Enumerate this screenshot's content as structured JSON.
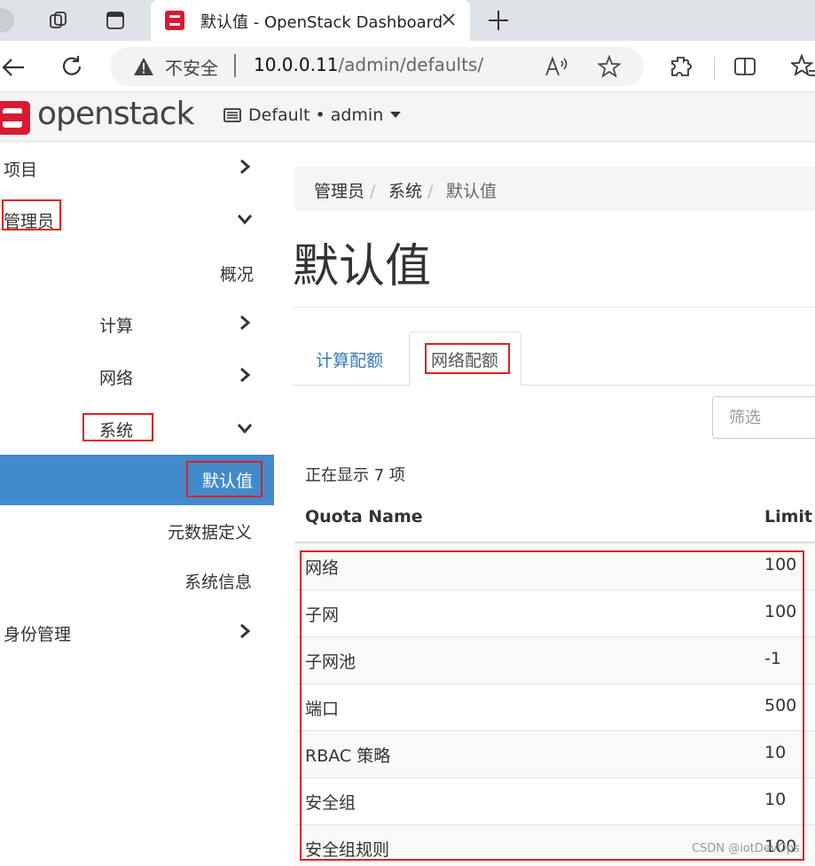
{
  "browser": {
    "tab_title": "默认值 - OpenStack Dashboard",
    "insecure_label": "不安全",
    "url_host": "10.0.0.11",
    "url_path": "/admin/defaults/"
  },
  "header": {
    "logo_text": "openstack",
    "logo_reg": "®",
    "project_label": "Default • admin"
  },
  "sidebar": {
    "project": "项目",
    "admin": "管理员",
    "overview": "概况",
    "compute": "计算",
    "network": "网络",
    "system": "系统",
    "defaults": "默认值",
    "metadata": "元数据定义",
    "system_info": "系统信息",
    "identity": "身份管理"
  },
  "breadcrumb": {
    "items": [
      "管理员",
      "系统",
      "默认值"
    ],
    "separator": "/"
  },
  "page": {
    "title": "默认值",
    "tabs": [
      "计算配额",
      "网络配额"
    ],
    "filter_placeholder": "筛选",
    "count_text": "正在显示 7 项"
  },
  "table": {
    "headers": [
      "Quota Name",
      "Limit"
    ],
    "rows": [
      {
        "name": "网络",
        "limit": "100"
      },
      {
        "name": "子网",
        "limit": "100"
      },
      {
        "name": "子网池",
        "limit": "-1"
      },
      {
        "name": "端口",
        "limit": "500"
      },
      {
        "name": "RBAC 策略",
        "limit": "10"
      },
      {
        "name": "安全组",
        "limit": "10"
      },
      {
        "name": "安全组规则",
        "limit": "100"
      }
    ]
  },
  "watermark": "CSDN @iotDevOps",
  "colors": {
    "accent": "#428bca",
    "link": "#337ab7",
    "brand": "#da1a32",
    "highlight": "#e02020"
  }
}
